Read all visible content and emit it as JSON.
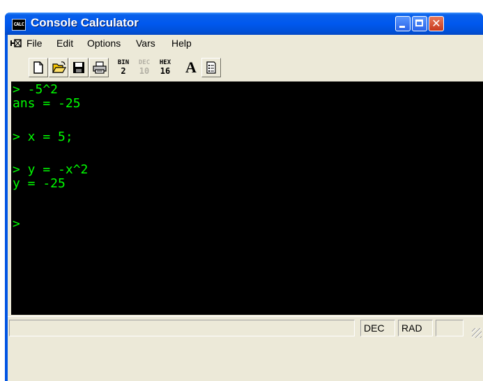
{
  "window": {
    "title": "Console Calculator",
    "icon_text": "CALC",
    "controls": {
      "minimize": "minimize",
      "maximize": "maximize",
      "close": "close"
    }
  },
  "menubar": {
    "system_icon": "⛿",
    "items": [
      "File",
      "Edit",
      "Options",
      "Vars",
      "Help"
    ]
  },
  "toolbar": {
    "new_icon": "new-document-icon",
    "open_icon": "open-folder-icon",
    "save_icon": "save-disk-icon",
    "print_icon": "printer-icon",
    "bin": {
      "top": "BIN",
      "bottom": "2"
    },
    "dec": {
      "top": "DEC",
      "bottom": "10",
      "disabled": true
    },
    "hex": {
      "top": "HEX",
      "bottom": "16"
    },
    "font_label": "A",
    "list_icon": "list-icon"
  },
  "console": {
    "lines": [
      "> -5^2",
      "ans = -25",
      "",
      "> x = 5;",
      "",
      "> y = -x^2",
      "y = -25",
      "",
      ">"
    ],
    "text_color": "#00ff00",
    "background": "#000000"
  },
  "statusbar": {
    "mode": "DEC",
    "angle": "RAD"
  }
}
